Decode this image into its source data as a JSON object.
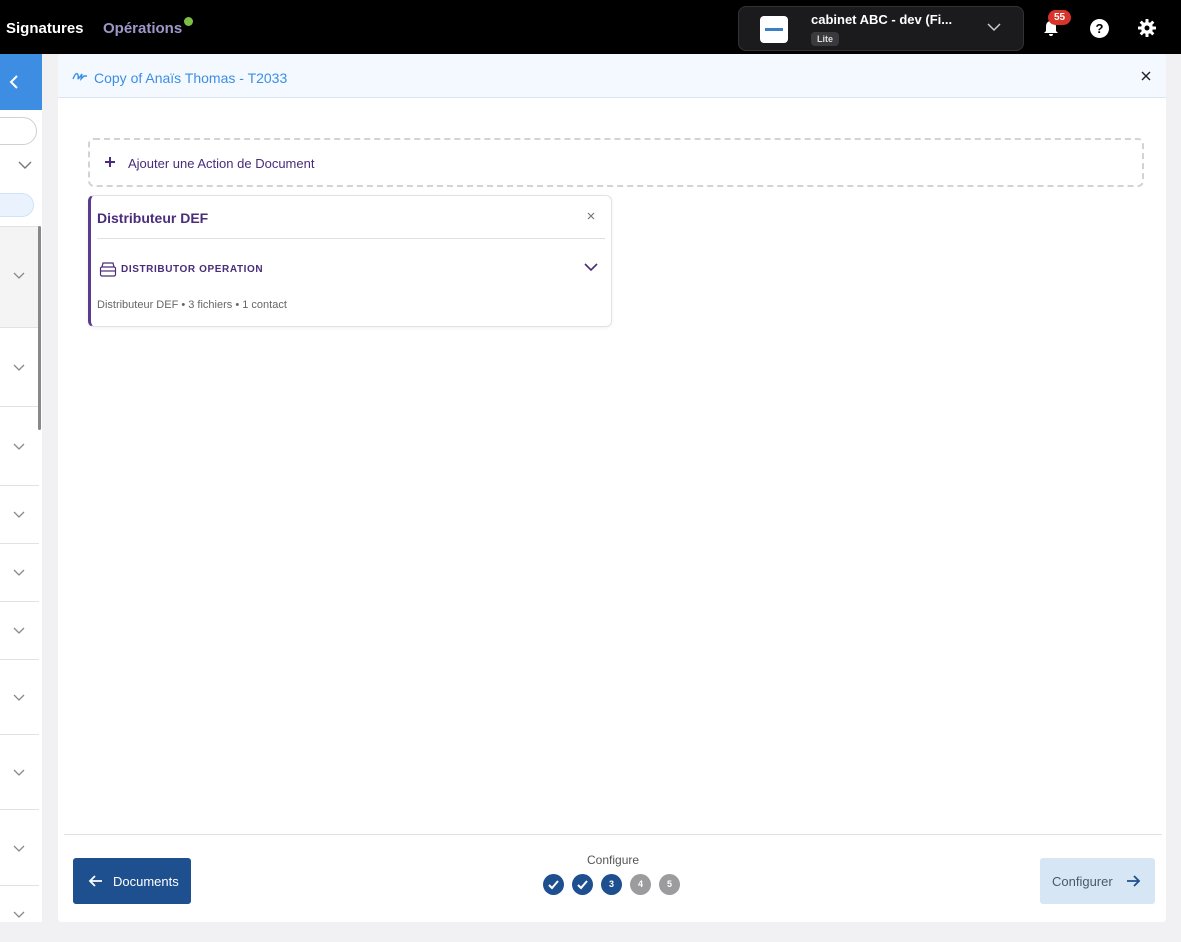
{
  "topbar": {
    "nav_signatures": "Signatures",
    "nav_operations": "Opérations",
    "org_name": "cabinet ABC - dev (Fi...",
    "org_plan": "Lite",
    "notifications_count": "55",
    "help_label": "?"
  },
  "modal": {
    "title": "Copy of Anaïs Thomas - T2033",
    "add_action_label": "Ajouter une Action de Document",
    "card": {
      "title": "Distributeur DEF",
      "operation_label": "DISTRIBUTOR OPERATION",
      "meta": "Distributeur DEF • 3 fichiers • 1 contact"
    },
    "footer": {
      "back_label": "Documents",
      "step_caption": "Configure",
      "steps": [
        {
          "label": "",
          "status": "done"
        },
        {
          "label": "",
          "status": "done"
        },
        {
          "label": "3",
          "status": "active"
        },
        {
          "label": "4",
          "status": "todo"
        },
        {
          "label": "5",
          "status": "todo"
        }
      ],
      "next_label": "Configurer"
    }
  },
  "colors": {
    "accent_blue": "#3d8ee3",
    "primary_dark_blue": "#1e4f8f",
    "purple": "#4a2c7a",
    "badge_red": "#d9342b",
    "status_green": "#7bc043"
  }
}
